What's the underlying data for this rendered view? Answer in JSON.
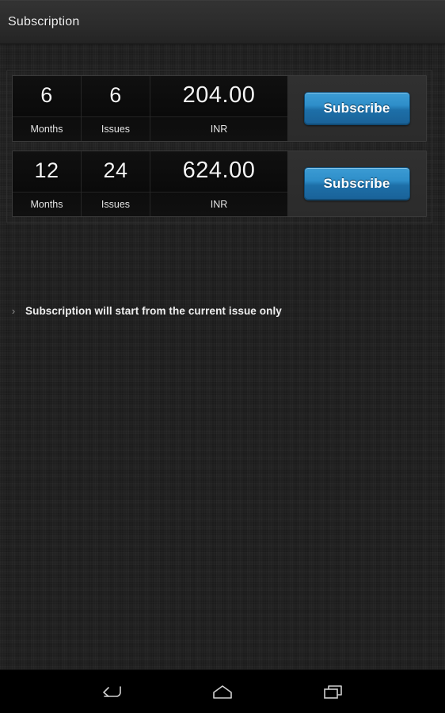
{
  "actionbar": {
    "title": "Subscription"
  },
  "plans": {
    "columns": {
      "months_label": "Months",
      "issues_label": "Issues",
      "currency_label": "INR"
    },
    "items": [
      {
        "months": "6",
        "issues": "6",
        "price": "204.00",
        "currency": "INR",
        "months_label": "Months",
        "issues_label": "Issues",
        "action_label": "Subscribe"
      },
      {
        "months": "12",
        "issues": "24",
        "price": "624.00",
        "currency": "INR",
        "months_label": "Months",
        "issues_label": "Issues",
        "action_label": "Subscribe"
      }
    ]
  },
  "note": {
    "marker": "›",
    "text": "Subscription will start from the current issue only"
  },
  "navbar": {
    "back_label": "Back",
    "home_label": "Home",
    "recents_label": "Recent apps"
  },
  "colors": {
    "accent_blue": "#2e8ec9",
    "accent_blue_dark": "#1a6298",
    "background": "#1d1d1d",
    "cell_background": "#0a0a0a",
    "actionbar": "#2c2c2c",
    "text_primary": "#f4f4f4"
  }
}
